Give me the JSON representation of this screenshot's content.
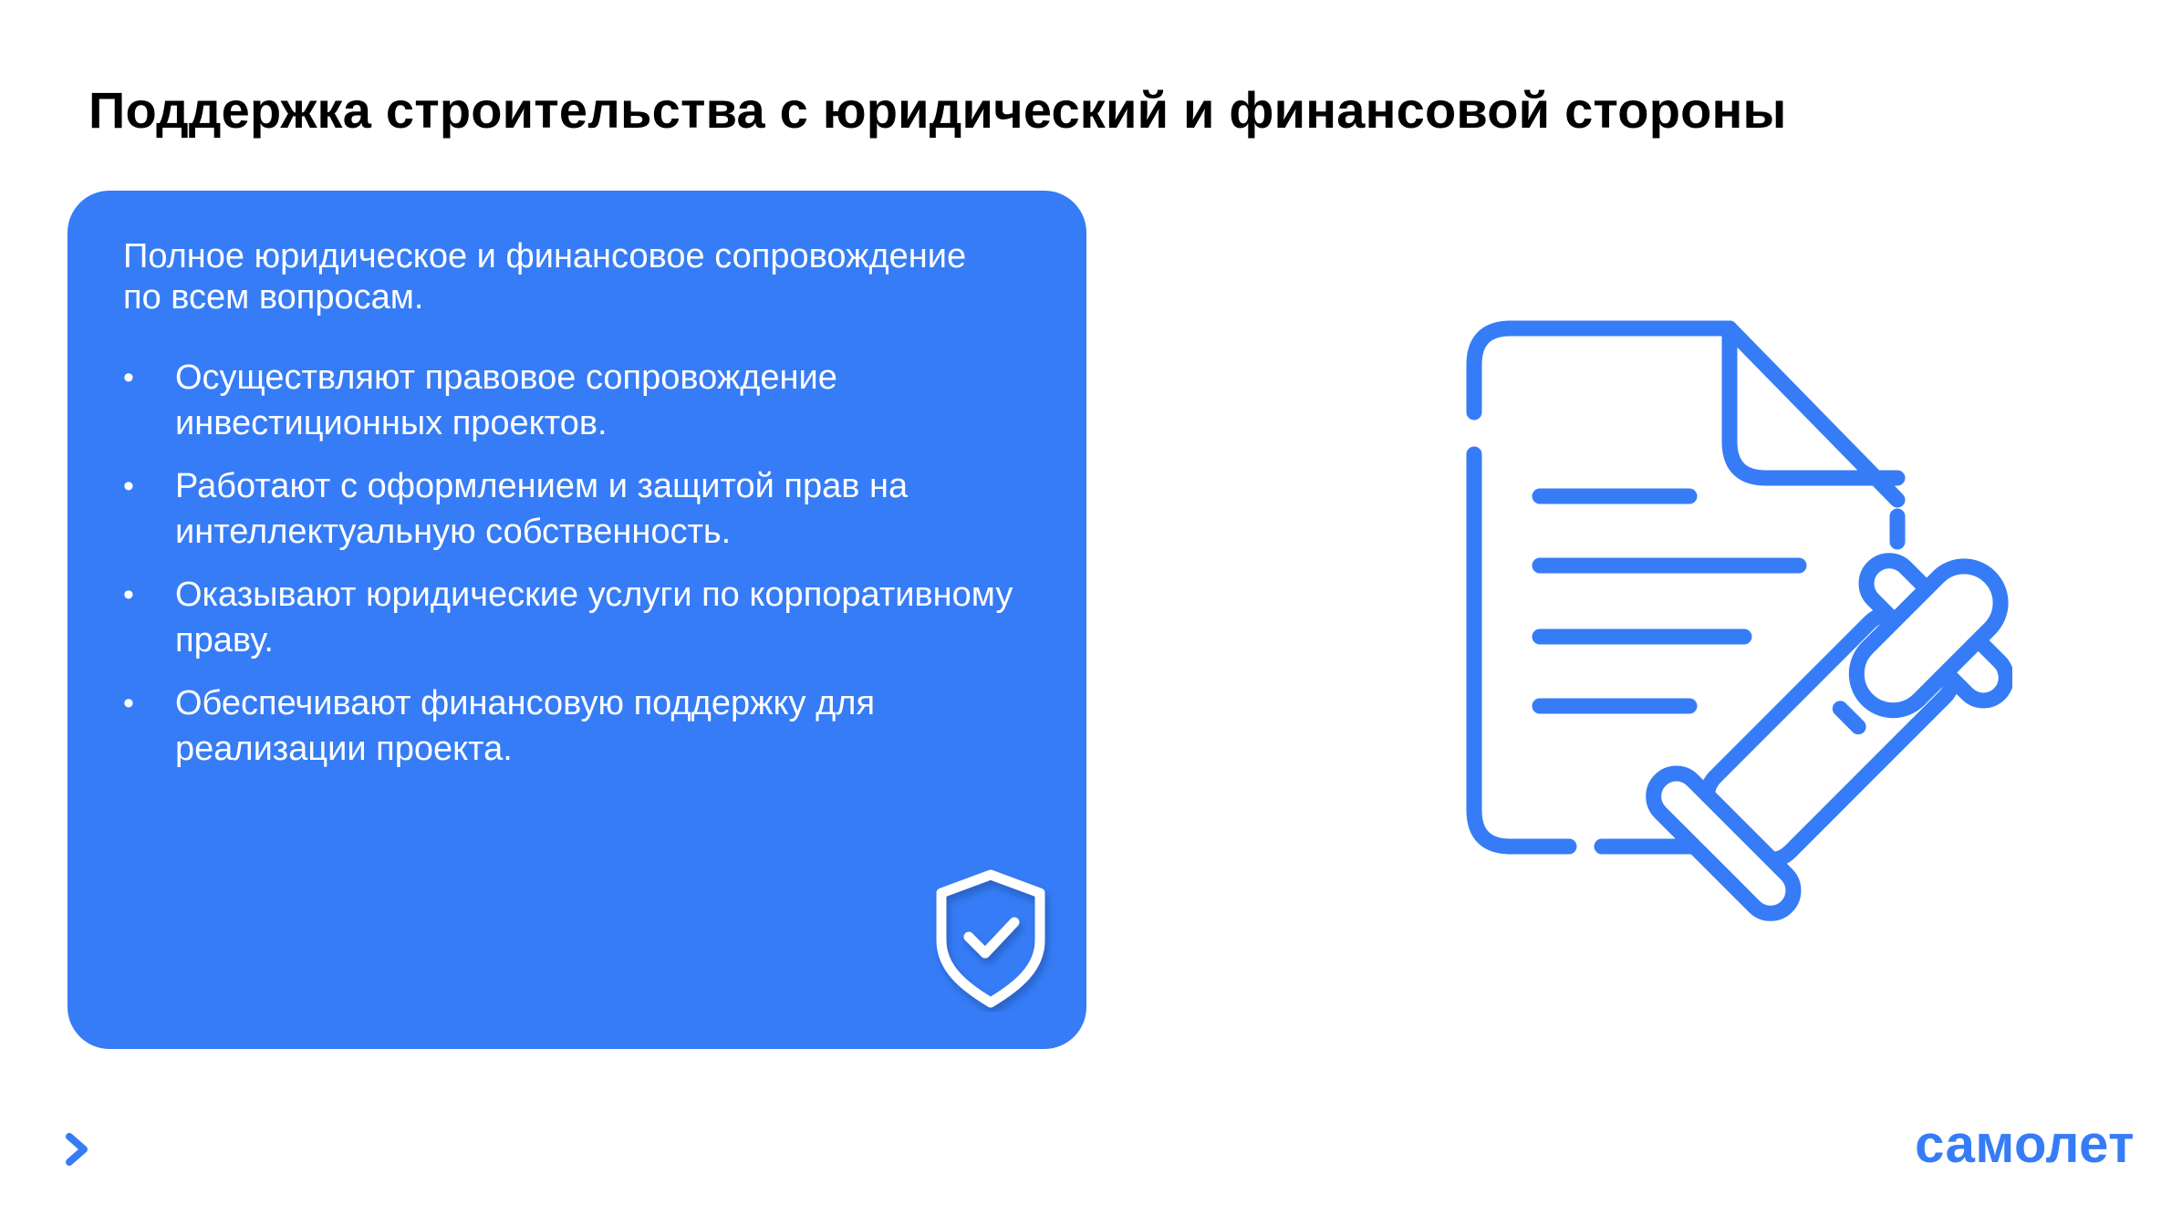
{
  "title": "Поддержка строительства с юридический и финансовой стороны",
  "card": {
    "intro": "Полное юридическое и финансовое сопровождение по всем вопросам.",
    "bullet_symbol": "•",
    "items": [
      {
        "text": "Осуществляют правовое сопровождение инвестиционных проектов."
      },
      {
        "text": "Работают с оформлением и защитой прав на интеллектуальную собственность."
      },
      {
        "text": "Оказывают юридические услуги по корпоративному праву."
      },
      {
        "text": "Обеспечивают финансовую поддержку для реализации проекта."
      }
    ],
    "icon": "shield-check-icon"
  },
  "illustration": "document-gavel-icon",
  "footer": {
    "nav_icon": "chevron-right-icon",
    "logo_text": "самолет"
  },
  "colors": {
    "accent": "#367cf6",
    "card_text": "#ffffff",
    "title_text": "#000000"
  }
}
